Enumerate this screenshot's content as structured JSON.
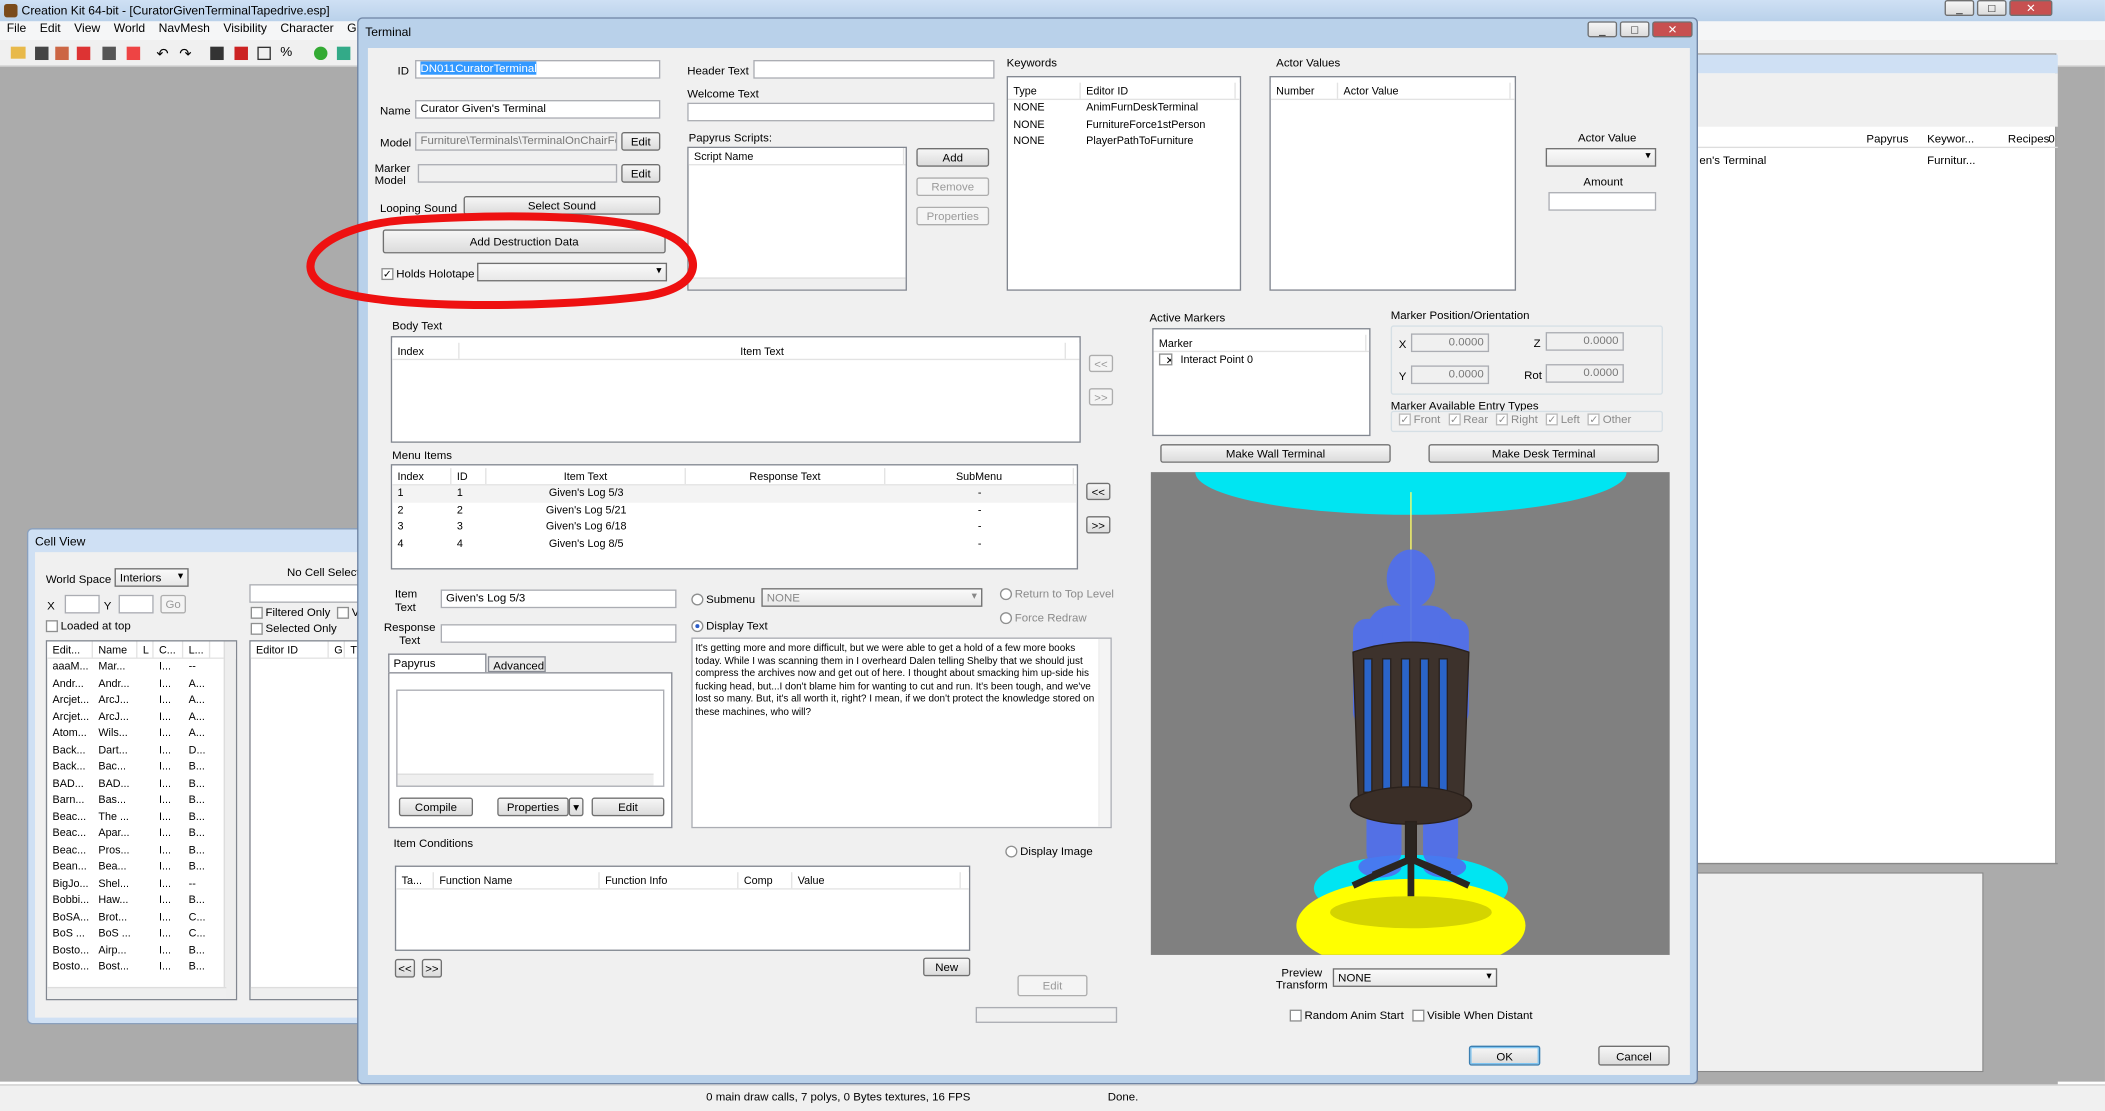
{
  "app": {
    "title": "Creation Kit 64-bit - [CuratorGivenTerminalTapedrive.esp]",
    "menu": [
      "File",
      "Edit",
      "View",
      "World",
      "NavMesh",
      "Visibility",
      "Character",
      "G"
    ],
    "status": {
      "render": "0 main draw calls, 7 polys, 0 Bytes textures, 16 FPS",
      "state": "Done."
    }
  },
  "bg_object_window": {
    "columns": [
      "Papyrus",
      "Keywor...",
      "Recipes",
      "0"
    ],
    "row": {
      "name": "en's Terminal",
      "keywords": "Furnitur..."
    }
  },
  "cell_view": {
    "title": "Cell View",
    "world_space_label": "World Space",
    "world_space_value": "Interiors",
    "x_label": "X",
    "y_label": "Y",
    "go_label": "Go",
    "loaded_at_top": "Loaded at top",
    "no_cell": "No Cell Selecte",
    "filtered_only": "Filtered Only",
    "selected_only": "Selected Only",
    "v_label": "V",
    "left_columns": [
      "Edit...",
      "Name",
      "L",
      "C...",
      "L..."
    ],
    "rows": [
      [
        "aaaM...",
        "Mar...",
        "I...",
        "--"
      ],
      [
        "Andr...",
        "Andr...",
        "I...",
        "A..."
      ],
      [
        "Arcjet...",
        "ArcJ...",
        "I...",
        "A..."
      ],
      [
        "Arcjet...",
        "ArcJ...",
        "I...",
        "A..."
      ],
      [
        "Atom...",
        "Wils...",
        "I...",
        "A..."
      ],
      [
        "Back...",
        "Dart...",
        "I...",
        "D..."
      ],
      [
        "Back...",
        "Bac...",
        "I...",
        "B..."
      ],
      [
        "BAD...",
        "BAD...",
        "I...",
        "B..."
      ],
      [
        "Barn...",
        "Bas...",
        "I...",
        "B..."
      ],
      [
        "Beac...",
        "The ...",
        "I...",
        "B..."
      ],
      [
        "Beac...",
        "Apar...",
        "I...",
        "B..."
      ],
      [
        "Beac...",
        "Pros...",
        "I...",
        "B..."
      ],
      [
        "Bean...",
        "Bea...",
        "I...",
        "B..."
      ],
      [
        "BigJo...",
        "Shel...",
        "I...",
        "--"
      ],
      [
        "Bobbi...",
        "Haw...",
        "I...",
        "B..."
      ],
      [
        "BoSA...",
        "Brot...",
        "I...",
        "C..."
      ],
      [
        "BoS ...",
        "BoS ...",
        "I...",
        "C..."
      ],
      [
        "Bosto...",
        "Airp...",
        "I...",
        "B..."
      ],
      [
        "Bosto...",
        "Bost...",
        "I...",
        "B..."
      ]
    ],
    "right_columns": [
      "Editor ID",
      "G",
      "T"
    ]
  },
  "terminal": {
    "title": "Terminal",
    "id_label": "ID",
    "id_value": "DN011CuratorTerminal",
    "name_label": "Name",
    "name_value": "Curator Given's Terminal",
    "model_label": "Model",
    "model_value": "Furniture\\Terminals\\TerminalOnChairFec",
    "edit_label": "Edit",
    "marker_model_label": "Marker Model",
    "looping_sound_label": "Looping Sound",
    "select_sound_label": "Select Sound",
    "add_destruction_label": "Add Destruction Data",
    "holds_holotape_label": "Holds Holotape",
    "header_text_label": "Header Text",
    "welcome_text_label": "Welcome Text",
    "papyrus_scripts_label": "Papyrus Scripts:",
    "script_name_col": "Script Name",
    "add_label": "Add",
    "remove_label": "Remove",
    "properties_label": "Properties",
    "keywords_label": "Keywords",
    "keywords_cols": [
      "Type",
      "Editor ID"
    ],
    "keywords": [
      {
        "type": "NONE",
        "id": "AnimFurnDeskTerminal"
      },
      {
        "type": "NONE",
        "id": "FurnitureForce1stPerson"
      },
      {
        "type": "NONE",
        "id": "PlayerPathToFurniture"
      }
    ],
    "actor_values_label": "Actor Values",
    "actor_values_cols": [
      "Number",
      "Actor Value"
    ],
    "actor_value_label": "Actor Value",
    "amount_label": "Amount",
    "body_text_label": "Body Text",
    "body_cols": [
      "Index",
      "Item Text"
    ],
    "menu_items_label": "Menu Items",
    "menu_cols": [
      "Index",
      "ID",
      "Item Text",
      "Response Text",
      "SubMenu"
    ],
    "menu_items": [
      {
        "index": "1",
        "id": "1",
        "text": "Given's Log 5/3",
        "response": "",
        "submenu": "-"
      },
      {
        "index": "2",
        "id": "2",
        "text": "Given's Log 5/21",
        "response": "",
        "submenu": "-"
      },
      {
        "index": "3",
        "id": "3",
        "text": "Given's Log 6/18",
        "response": "",
        "submenu": "-"
      },
      {
        "index": "4",
        "id": "4",
        "text": "Given's Log 8/5",
        "response": "",
        "submenu": "-"
      }
    ],
    "prev_label": "<<",
    "next_label": ">>",
    "item_text_label": "Item Text",
    "item_text_value": "Given's Log 5/3",
    "response_text_label": "Response Text",
    "submenu_label": "Submenu",
    "submenu_value": "NONE",
    "display_text_label": "Display Text",
    "return_top_label": "Return to Top Level",
    "force_redraw_label": "Force Redraw",
    "display_body": "It's getting more and more difficult, but we were able to get a hold of a few more books today.  While I was scanning them in I overheard Dalen telling Shelby that we should just compress the archives now and get out of here.  I thought about smacking him up-side his fucking head, but...I don't blame him for wanting to cut and run.  It's been tough, and we've lost so many.  But, it's all worth it, right?  I mean, if we don't protect the knowledge stored on these machines, who will?",
    "papyrus_fragment_tab": "Papyrus Fragment",
    "advanced_tab": "Advanced",
    "compile_label": "Compile",
    "item_conditions_label": "Item Conditions",
    "cond_cols": [
      "Ta...",
      "Function Name",
      "Function Info",
      "Comp",
      "Value"
    ],
    "new_label": "New",
    "display_image_label": "Display Image",
    "active_markers_label": "Active Markers",
    "marker_col": "Marker",
    "marker_item": "Interact Point 0",
    "marker_pos_label": "Marker Position/Orientation",
    "pos": {
      "x": "0.0000",
      "y": "0.0000",
      "z": "0.0000",
      "rot": "0.0000"
    },
    "x_label": "X",
    "y_label": "Y",
    "z_label": "Z",
    "rot_label": "Rot",
    "entry_types_label": "Marker Available Entry Types",
    "entry_types": [
      "Front",
      "Rear",
      "Right",
      "Left",
      "Other"
    ],
    "make_wall_label": "Make Wall Terminal",
    "make_desk_label": "Make Desk Terminal",
    "preview_transform_label": "Preview Transform",
    "preview_transform_value": "NONE",
    "random_anim_label": "Random Anim Start",
    "visible_distant_label": "Visible When Distant",
    "ok_label": "OK",
    "cancel_label": "Cancel"
  }
}
